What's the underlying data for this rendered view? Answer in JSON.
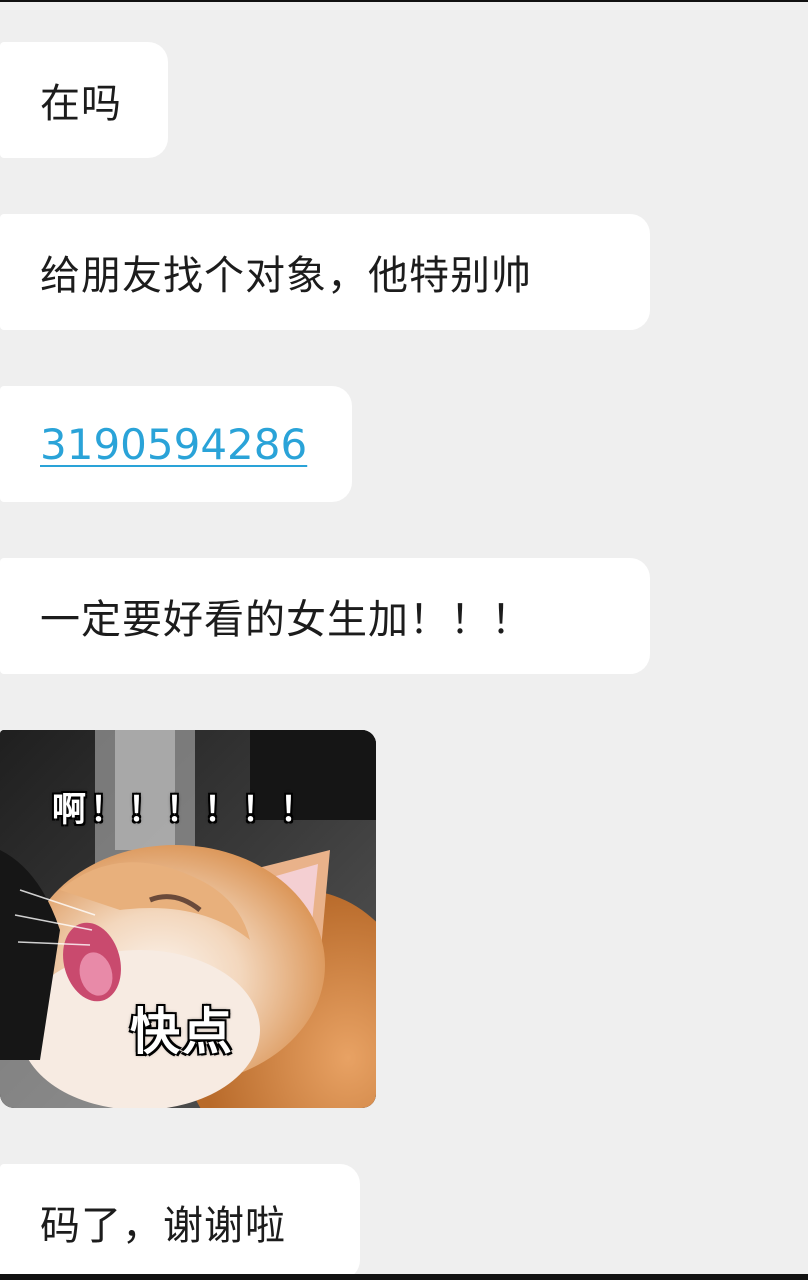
{
  "messages": [
    {
      "text": "在吗"
    },
    {
      "text": "给朋友找个对象，他特别帅"
    },
    {
      "link": "3190594286"
    },
    {
      "text": "一定要好看的女生加！！！"
    },
    {
      "text": "码了，谢谢啦"
    }
  ],
  "sticker": {
    "top_text": "啊！！！！！！",
    "bottom_text": "快点"
  },
  "colors": {
    "background": "#efefef",
    "bubble": "#ffffff",
    "link": "#2aa3d8",
    "text": "#1c1c1c"
  }
}
